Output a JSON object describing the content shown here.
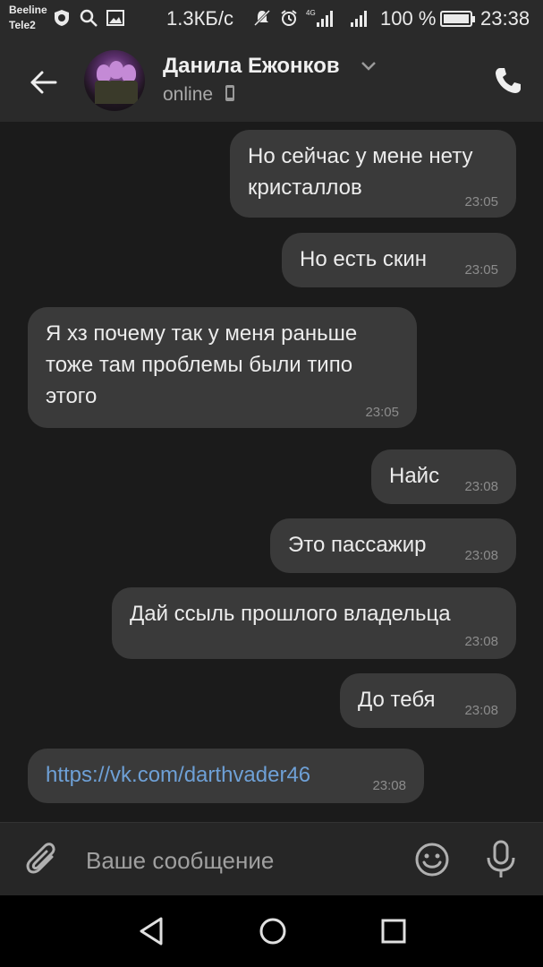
{
  "status_bar": {
    "carrier1": "Beeline",
    "carrier2": "Tele2",
    "net_speed": "1.3КБ/с",
    "network_type": "4G",
    "battery_percent": "100 %",
    "time": "23:38"
  },
  "header": {
    "contact_name": "Данила Ежонков",
    "status": "online"
  },
  "messages": [
    {
      "side": "out",
      "lines": "Но сейчас у мене нету\nкристаллов",
      "time": "23:05"
    },
    {
      "side": "out",
      "lines": "Но есть скин",
      "time": "23:05"
    },
    {
      "side": "in",
      "lines": "Я хз почему так у меня раньше\nтоже там проблемы были типо\nэтого",
      "time": "23:05"
    },
    {
      "side": "out",
      "lines": "Найс",
      "time": "23:08"
    },
    {
      "side": "out",
      "lines": "Это пассажир",
      "time": "23:08"
    },
    {
      "side": "out",
      "lines": "Дай ссыль прошлого владельца",
      "time": "23:08"
    },
    {
      "side": "out",
      "lines": "До тебя",
      "time": "23:08"
    },
    {
      "side": "in",
      "lines": "https://vk.com/darthvader46",
      "time": "23:08",
      "is_link": true
    }
  ],
  "composer": {
    "placeholder": "Ваше сообщение"
  },
  "colors": {
    "background": "#1b1b1b",
    "bar": "#2a2a2a",
    "bubble": "#3a3a3a",
    "link": "#6ea0d6"
  }
}
